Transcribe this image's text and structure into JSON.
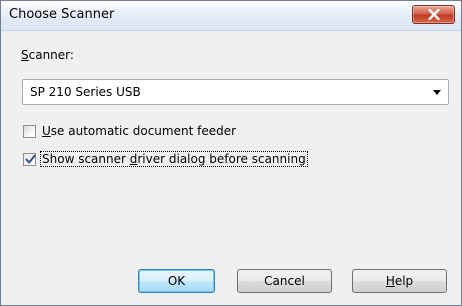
{
  "window": {
    "title": "Choose Scanner"
  },
  "scanner": {
    "label_accel": "S",
    "label_rest": "canner:",
    "selected": "SP 210 Series USB"
  },
  "options": {
    "adf": {
      "accel": "U",
      "rest": "se automatic document feeder",
      "checked": false
    },
    "driver_dialog": {
      "pre": "Show scanner ",
      "accel": "d",
      "rest": "river dialog before scanning",
      "checked": true
    }
  },
  "buttons": {
    "ok": "OK",
    "cancel": "Cancel",
    "help_accel": "H",
    "help_rest": "elp"
  },
  "icons": {
    "close": "close-icon",
    "dropdown": "chevron-down-icon",
    "check": "checkmark-icon"
  }
}
